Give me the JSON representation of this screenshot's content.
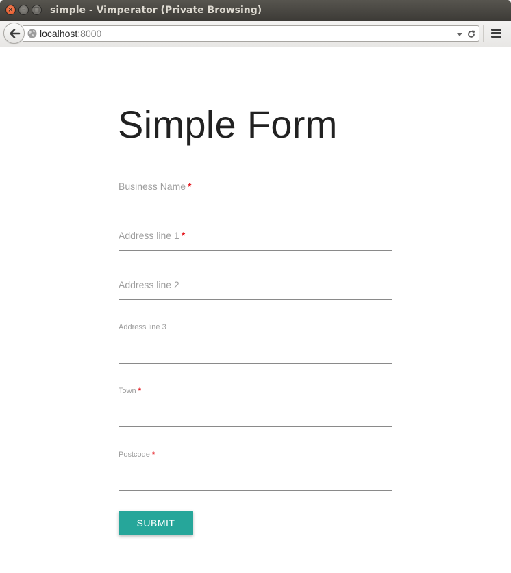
{
  "window": {
    "title": "simple - Vimperator (Private Browsing)",
    "close_glyph": "×",
    "minimize_glyph": "–",
    "maximize_glyph": "□"
  },
  "navbar": {
    "url_host": "localhost",
    "url_port": ":8000",
    "icons": [
      "back-arrow-icon",
      "globe-icon",
      "dropdown-arrow-icon",
      "reload-icon",
      "hamburger-menu-icon"
    ]
  },
  "page": {
    "title": "Simple Form",
    "required_marker": "*",
    "accent_color": "#26a69a",
    "required_color": "#e51c23",
    "fields": [
      {
        "label": "Business Name",
        "required": true,
        "value": ""
      },
      {
        "label": "Address line 1",
        "required": true,
        "value": ""
      },
      {
        "label": "Address line 2",
        "required": false,
        "value": ""
      },
      {
        "label": "Address line 3",
        "required": false,
        "value": ""
      },
      {
        "label": "Town",
        "required": true,
        "value": ""
      },
      {
        "label": "Postcode",
        "required": true,
        "value": ""
      }
    ],
    "submit_label": "SUBMIT"
  }
}
